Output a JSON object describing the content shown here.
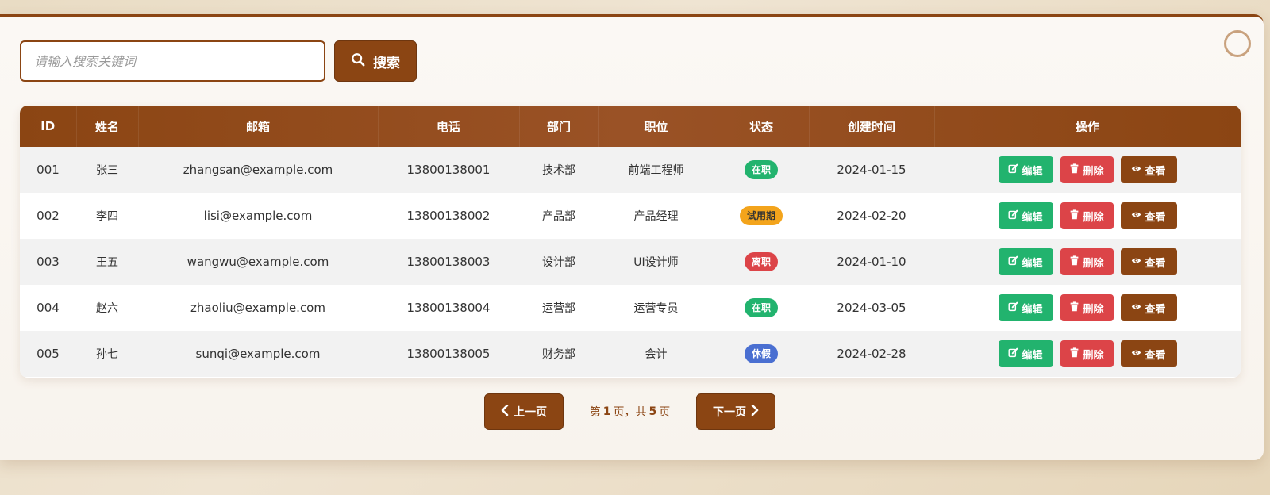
{
  "search": {
    "placeholder": "请输入搜索关键词",
    "button_label": "搜索"
  },
  "table": {
    "headers": [
      "ID",
      "姓名",
      "邮箱",
      "电话",
      "部门",
      "职位",
      "状态",
      "创建时间",
      "操作"
    ],
    "rows": [
      {
        "id": "001",
        "name": "张三",
        "email": "zhangsan@example.com",
        "phone": "13800138001",
        "dept": "技术部",
        "position": "前端工程师",
        "status": "在职",
        "status_color": "#22b36e",
        "created": "2024-01-15"
      },
      {
        "id": "002",
        "name": "李四",
        "email": "lisi@example.com",
        "phone": "13800138002",
        "dept": "产品部",
        "position": "产品经理",
        "status": "试用期",
        "status_color": "#f3a41c",
        "created": "2024-02-20"
      },
      {
        "id": "003",
        "name": "王五",
        "email": "wangwu@example.com",
        "phone": "13800138003",
        "dept": "设计部",
        "position": "UI设计师",
        "status": "离职",
        "status_color": "#dc4448",
        "created": "2024-01-10"
      },
      {
        "id": "004",
        "name": "赵六",
        "email": "zhaoliu@example.com",
        "phone": "13800138004",
        "dept": "运营部",
        "position": "运营专员",
        "status": "在职",
        "status_color": "#22b36e",
        "created": "2024-03-05"
      },
      {
        "id": "005",
        "name": "孙七",
        "email": "sunqi@example.com",
        "phone": "13800138005",
        "dept": "财务部",
        "position": "会计",
        "status": "休假",
        "status_color": "#4a6fd1",
        "created": "2024-02-28"
      }
    ],
    "actions": {
      "edit": "编辑",
      "delete": "删除",
      "view": "查看"
    }
  },
  "pagination": {
    "prev_label": "上一页",
    "next_label": "下一页",
    "prefix": "第",
    "current": "1",
    "middle": "页，共",
    "total": "5",
    "suffix": "页"
  },
  "colors": {
    "brand": "#8b4513",
    "edit": "#22b36e",
    "delete": "#dc4448",
    "pending": "#f3a41c"
  }
}
